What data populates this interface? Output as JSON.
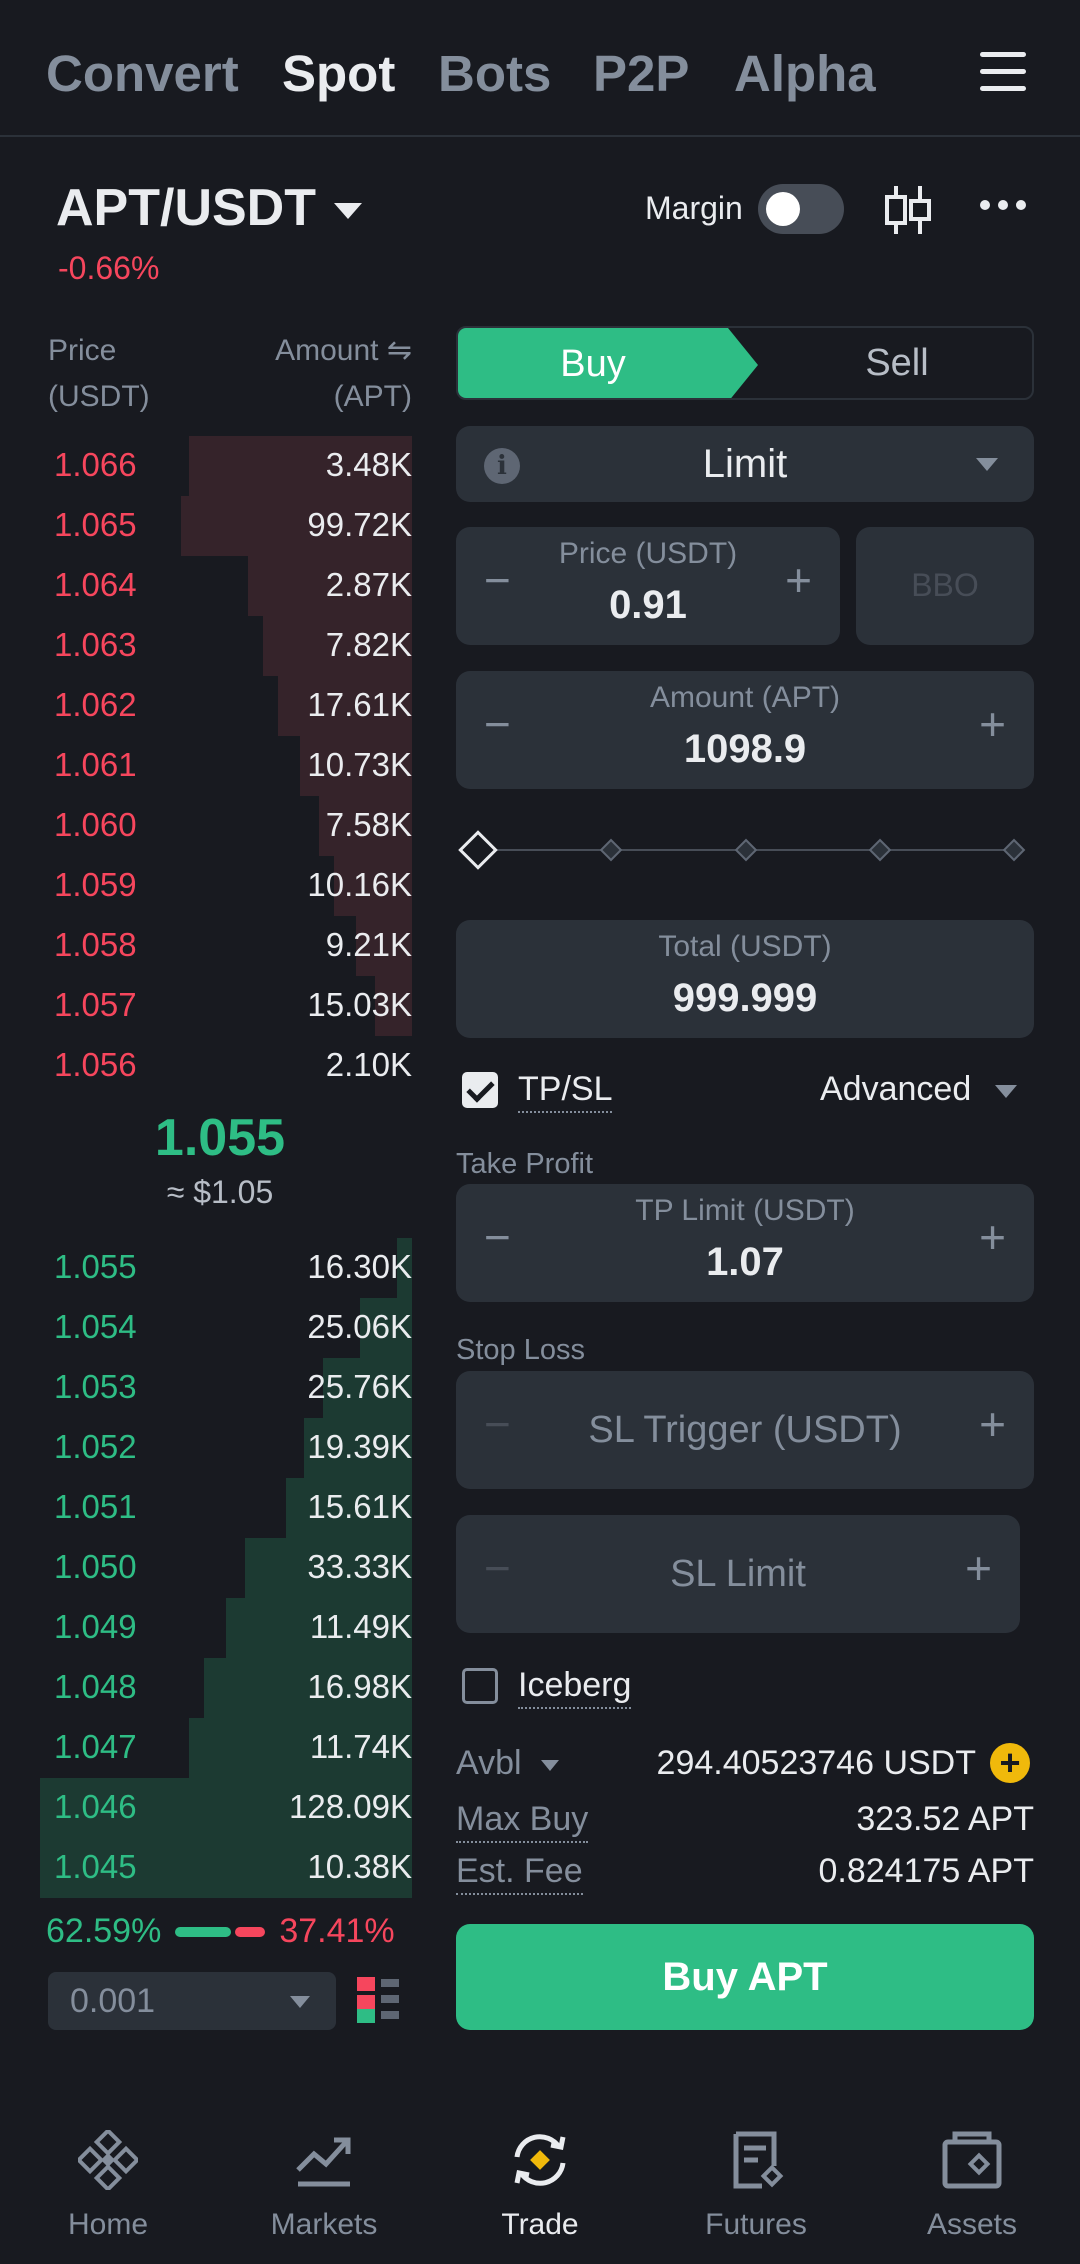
{
  "top_tabs": [
    "Convert",
    "Spot",
    "Bots",
    "P2P",
    "Alpha"
  ],
  "pair": {
    "symbol": "APT/USDT",
    "change": "-0.66%"
  },
  "margin": {
    "label": "Margin",
    "enabled": false
  },
  "orderbook": {
    "price_header": "Price",
    "price_unit": "(USDT)",
    "amount_header": "Amount ⇋",
    "amount_unit": "(APT)",
    "asks": [
      {
        "price": "1.066",
        "amount": "3.48K",
        "depth": 0.6
      },
      {
        "price": "1.065",
        "amount": "99.72K",
        "depth": 0.62
      },
      {
        "price": "1.064",
        "amount": "2.87K",
        "depth": 0.44
      },
      {
        "price": "1.063",
        "amount": "7.82K",
        "depth": 0.4
      },
      {
        "price": "1.062",
        "amount": "17.61K",
        "depth": 0.36
      },
      {
        "price": "1.061",
        "amount": "10.73K",
        "depth": 0.3
      },
      {
        "price": "1.060",
        "amount": "7.58K",
        "depth": 0.25
      },
      {
        "price": "1.059",
        "amount": "10.16K",
        "depth": 0.21
      },
      {
        "price": "1.058",
        "amount": "9.21K",
        "depth": 0.15
      },
      {
        "price": "1.057",
        "amount": "15.03K",
        "depth": 0.1
      },
      {
        "price": "1.056",
        "amount": "2.10K",
        "depth": 0.0
      }
    ],
    "last_price": "1.055",
    "last_price_usd": "≈ $1.05",
    "bids": [
      {
        "price": "1.055",
        "amount": "16.30K",
        "depth": 0.04
      },
      {
        "price": "1.054",
        "amount": "25.06K",
        "depth": 0.14
      },
      {
        "price": "1.053",
        "amount": "25.76K",
        "depth": 0.24
      },
      {
        "price": "1.052",
        "amount": "19.39K",
        "depth": 0.29
      },
      {
        "price": "1.051",
        "amount": "15.61K",
        "depth": 0.34
      },
      {
        "price": "1.050",
        "amount": "33.33K",
        "depth": 0.45
      },
      {
        "price": "1.049",
        "amount": "11.49K",
        "depth": 0.5
      },
      {
        "price": "1.048",
        "amount": "16.98K",
        "depth": 0.56
      },
      {
        "price": "1.047",
        "amount": "11.74K",
        "depth": 0.6
      },
      {
        "price": "1.046",
        "amount": "128.09K",
        "depth": 1.0
      },
      {
        "price": "1.045",
        "amount": "10.38K",
        "depth": 1.0
      }
    ],
    "buy_ratio": "62.59%",
    "sell_ratio": "37.41%",
    "precision": "0.001"
  },
  "order_form": {
    "buy_label": "Buy",
    "sell_label": "Sell",
    "order_type": "Limit",
    "price_label": "Price (USDT)",
    "price_value": "0.91",
    "bbo_label": "BBO",
    "amount_label": "Amount (APT)",
    "amount_value": "1098.9",
    "slider_percent": 0,
    "total_label": "Total (USDT)",
    "total_value": "999.999",
    "tpsl_label": "TP/SL",
    "tpsl_checked": true,
    "advanced_label": "Advanced",
    "take_profit_label": "Take Profit",
    "tp_limit_label": "TP Limit (USDT)",
    "tp_limit_value": "1.07",
    "stop_loss_label": "Stop Loss",
    "sl_trigger_placeholder": "SL Trigger (USDT)",
    "sl_limit_placeholder": "SL Limit",
    "iceberg_label": "Iceberg",
    "iceberg_checked": false,
    "avbl_label": "Avbl",
    "avbl_value": "294.40523746 USDT",
    "max_buy_label": "Max Buy",
    "max_buy_value": "323.52 APT",
    "est_fee_label": "Est. Fee",
    "est_fee_value": "0.824175 APT",
    "submit_label": "Buy APT"
  },
  "nav": [
    {
      "label": "Home",
      "icon": "home-icon"
    },
    {
      "label": "Markets",
      "icon": "markets-icon"
    },
    {
      "label": "Trade",
      "icon": "trade-icon"
    },
    {
      "label": "Futures",
      "icon": "futures-icon"
    },
    {
      "label": "Assets",
      "icon": "assets-icon"
    }
  ],
  "colors": {
    "buy": "#2ebd85",
    "sell": "#f6465d",
    "accent": "#f0b90b",
    "bg": "#181a20"
  }
}
